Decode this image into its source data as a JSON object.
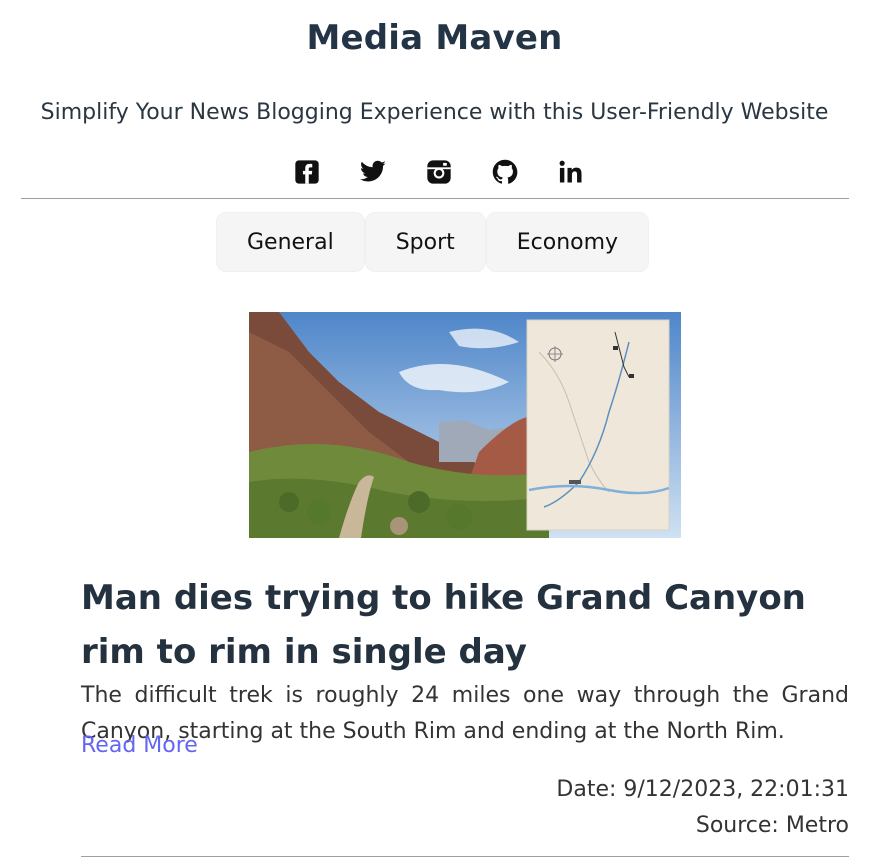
{
  "site": {
    "title": "Media Maven",
    "tagline": "Simplify Your News Blogging Experience with this User-Friendly Website"
  },
  "social": [
    {
      "name": "facebook-icon"
    },
    {
      "name": "twitter-icon"
    },
    {
      "name": "instagram-icon"
    },
    {
      "name": "github-icon"
    },
    {
      "name": "linkedin-icon",
      "label": "in"
    }
  ],
  "tabs": [
    {
      "label": "General"
    },
    {
      "label": "Sport"
    },
    {
      "label": "Economy"
    }
  ],
  "article": {
    "image_alt": "Grand Canyon trail with map",
    "title": "Man dies trying to hike Grand Canyon rim to rim in single day",
    "excerpt": "The difficult trek is roughly 24 miles one way through the Grand Canyon, starting at the South Rim and ending at the North Rim.",
    "read_more": "Read More",
    "date": "Date: 9/12/2023, 22:01:31",
    "source": "Source: Metro"
  },
  "colors": {
    "title": "#243447",
    "link": "#6366f1",
    "tab_bg": "#f5f5f5"
  }
}
